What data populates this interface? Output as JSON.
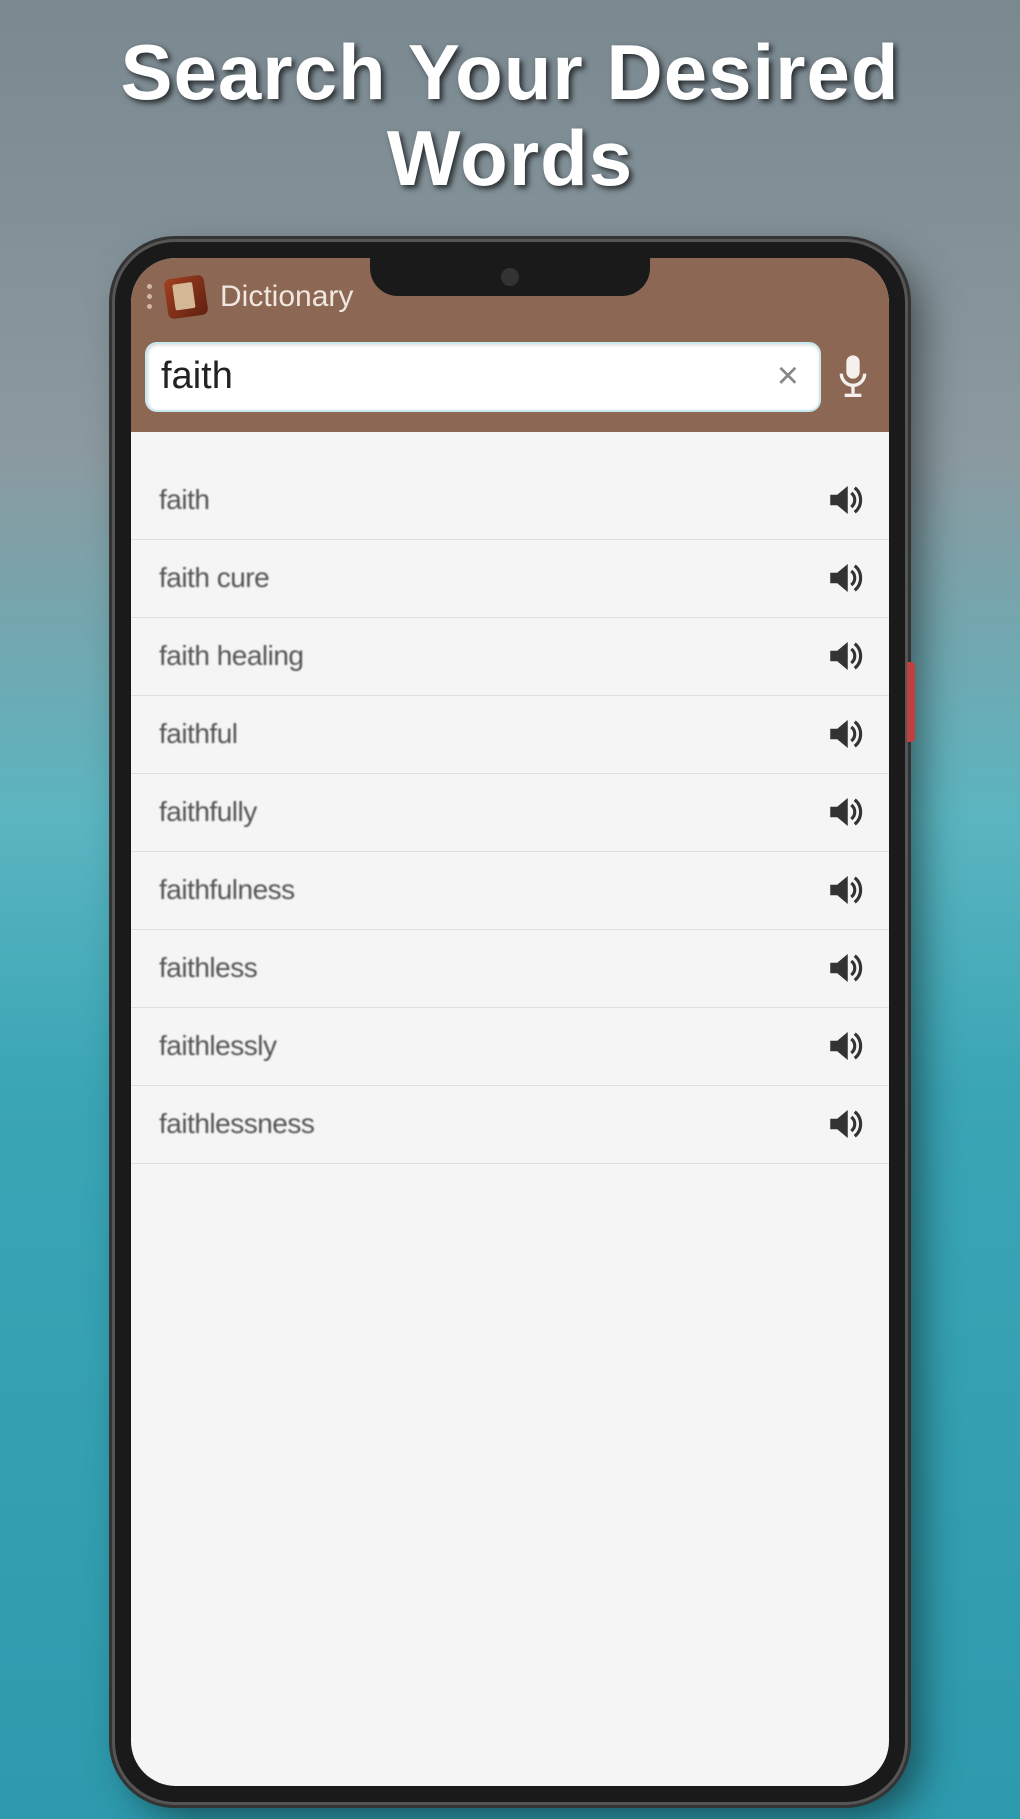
{
  "promo": {
    "title_line1": "Search Your Desired",
    "title_line2": "Words"
  },
  "header": {
    "app_title": "Dictionary"
  },
  "search": {
    "value": "faith",
    "clear_label": "×"
  },
  "results": [
    {
      "word": "faith"
    },
    {
      "word": "faith cure"
    },
    {
      "word": "faith healing"
    },
    {
      "word": "faithful"
    },
    {
      "word": "faithfully"
    },
    {
      "word": "faithfulness"
    },
    {
      "word": "faithless"
    },
    {
      "word": "faithlessly"
    },
    {
      "word": "faithlessness"
    }
  ]
}
